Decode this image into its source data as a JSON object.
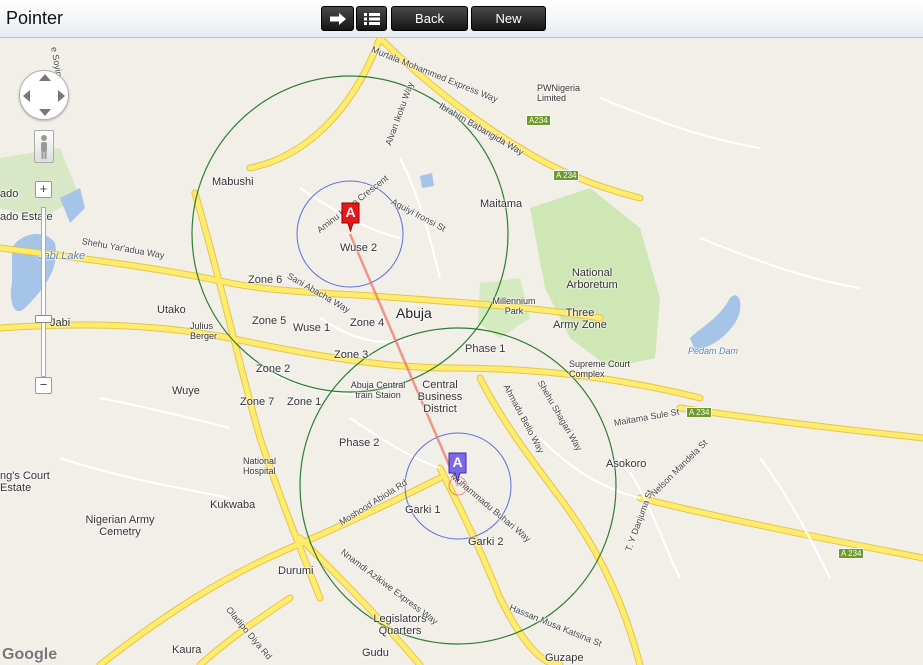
{
  "app": {
    "title": "Pointer"
  },
  "toolbar": {
    "forward_icon": "arrow-right-icon",
    "list_icon": "list-icon",
    "back_label": "Back",
    "new_label": "New"
  },
  "map_controls": {
    "zoom_in": "+",
    "zoom_out": "−",
    "pan_icon": "pan-control-icon",
    "pegman_icon": "street-view-pegman-icon",
    "attribution": "Google"
  },
  "markers": [
    {
      "letter": "A",
      "color": "#e8161b",
      "place": "Wuse 2"
    },
    {
      "letter": "A",
      "color": "#7b68ee",
      "place": "Garki 1"
    }
  ],
  "colors": {
    "outer_radius": "#2e7d32",
    "inner_radius": "#5a6ee0",
    "connector": "#f07060",
    "major_road": "#ffeb6e",
    "road_stroke": "#e3c64a",
    "park": "#cfe6b5",
    "water": "#a6c4e8"
  },
  "places": {
    "abuja": "Abuja",
    "wuse2": "Wuse 2",
    "maitama": "Maitama",
    "mabushi": "Mabushi",
    "zone6": "Zone 6",
    "zone5": "Zone 5",
    "zone4": "Zone 4",
    "zone3": "Zone 3",
    "zone2": "Zone 2",
    "zone7": "Zone 7",
    "zone1": "Zone 1",
    "wuse1": "Wuse 1",
    "utako": "Utako",
    "jabi": "Jabi",
    "jabi_lake": "Jabi Lake",
    "wuye": "Wuye",
    "julius_berger": "Julius Berger",
    "phase1": "Phase 1",
    "phase2": "Phase 2",
    "cbd": "Central Business District",
    "abuja_central_station": "Abuja Central train Staion",
    "millennium_park": "Millennium Park",
    "national_arboretum": "National Arboretum",
    "three_army_zone": "Three Army Zone",
    "supreme_court": "Supreme Court Complex",
    "pedam_dam": "Pedam Dam",
    "asokoro": "Asokoro",
    "garki1": "Garki 1",
    "garki2": "Garki 2",
    "national_hospital": "National Hospital",
    "kukwaba": "Kukwaba",
    "nigerian_army_cemetery": "Nigerian Army Cemetry",
    "durumi": "Durumi",
    "legislators_quarters": "Legislators Quarters",
    "kaura": "Kaura",
    "gudu": "Gudu",
    "guzape": "Guzape",
    "pwnigeria": "PWNigeria Limited",
    "kings_court": "ng's Court Estate",
    "ado": "ado",
    "ado_estate": "ado Estate"
  },
  "roads": {
    "murtala": "Murtala Mohammed Express Way",
    "ibb_way": "Ibrahim Babangida Way",
    "alvan_ikoku": "Alvan Ikoku Way",
    "aminu_kano": "Aminu Kano Crescent",
    "aguiyi_ironsi": "Aguiyi Ironsi St",
    "shehu_yaradua": "Shehu Yar'adua Way",
    "sani_abacha": "Sani Abacha Way",
    "ahmadu_bello": "Ahmadu Bello Way",
    "shehu_shagari": "Shehu Shagari Way",
    "moshood_abiola": "Moshood Abiola Rd",
    "muhammadu_buhari": "Muhammadu Buhari Way",
    "nnamdi_azikiwe": "Nnamdi Azikiwe Express Way",
    "hassan_musa_katsina": "Hassan Musa Katsina St",
    "oladipo_diya": "Oladipo Diya Rd",
    "maitama_sule": "Maitama Sule St",
    "nelson_mandela": "Nelson Mandela St",
    "ty_danjuma": "T. Y Danjuma St",
    "sa_soyinka": "e Soyin"
  },
  "shields": {
    "a234_1": "A234",
    "a234_2": "A 234",
    "a234_3": "A 234",
    "a234_4": "A 234"
  }
}
